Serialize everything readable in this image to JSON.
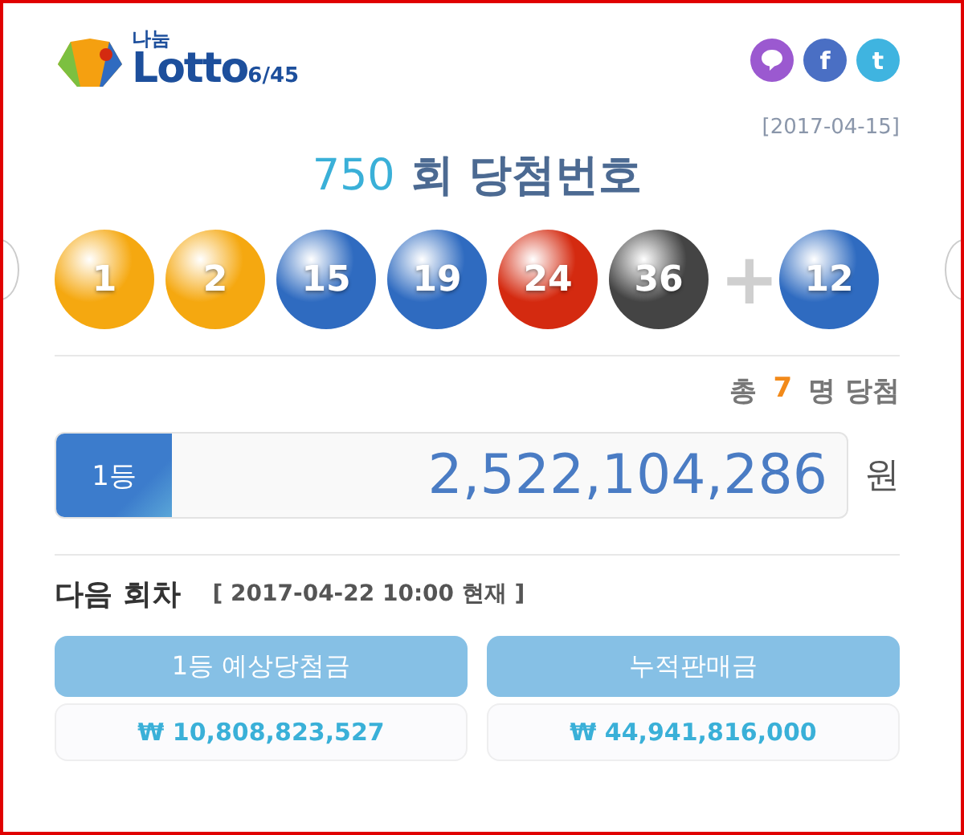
{
  "logo": {
    "top": "나눔",
    "main": "Lotto",
    "suffix": "6/45"
  },
  "share": [
    {
      "kind": "bubble",
      "color": "#9b59d0"
    },
    {
      "kind": "text",
      "label": "f",
      "color": "#4a6fc4"
    },
    {
      "kind": "text",
      "label": "t",
      "color": "#3fb4e0"
    }
  ],
  "draw_date": "[2017-04-15]",
  "title": {
    "round": "750",
    "text": "회 당첨번호"
  },
  "balls": [
    {
      "number": "1",
      "color": "#f5a810"
    },
    {
      "number": "2",
      "color": "#f5a810"
    },
    {
      "number": "15",
      "color": "#2f6bc0"
    },
    {
      "number": "19",
      "color": "#2f6bc0"
    },
    {
      "number": "24",
      "color": "#d42a10"
    },
    {
      "number": "36",
      "color": "#444444"
    }
  ],
  "plus": "+",
  "bonus": {
    "number": "12",
    "color": "#2f6bc0"
  },
  "winners": {
    "prefix": "총",
    "count": "7",
    "suffix": "명 당첨"
  },
  "prize": {
    "rank": "1등",
    "amount": "2,522,104,286",
    "unit": "원"
  },
  "next": {
    "label": "다음 회차",
    "info": "[ 2017-04-22 10:00 현재 ]"
  },
  "stats": [
    {
      "label": "1등 예상당첨금",
      "value": "₩ 10,808,823,527"
    },
    {
      "label": "누적판매금",
      "value": "₩ 44,941,816,000"
    }
  ]
}
